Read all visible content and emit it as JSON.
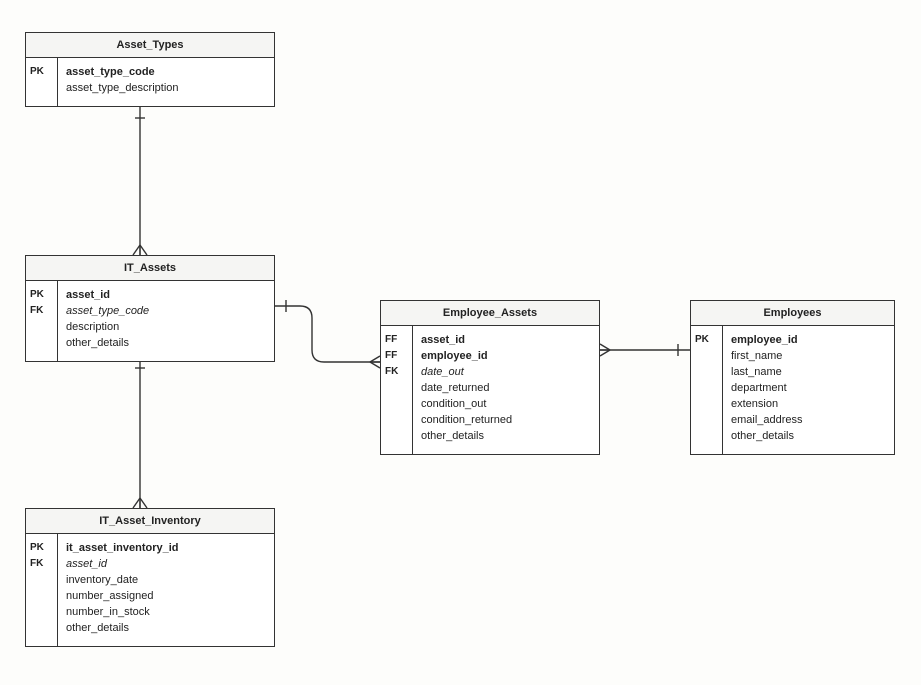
{
  "entities": {
    "asset_types": {
      "title": "Asset_Types",
      "keys": [
        "PK",
        ""
      ],
      "fields": [
        {
          "name": "asset_type_code",
          "bold": true
        },
        {
          "name": "asset_type_description"
        }
      ]
    },
    "it_assets": {
      "title": "IT_Assets",
      "keys": [
        "PK",
        "FK",
        "",
        ""
      ],
      "fields": [
        {
          "name": "asset_id",
          "bold": true
        },
        {
          "name": "asset_type_code",
          "italic": true
        },
        {
          "name": "description"
        },
        {
          "name": "other_details"
        }
      ]
    },
    "it_asset_inventory": {
      "title": "IT_Asset_Inventory",
      "keys": [
        "PK",
        "FK",
        "",
        "",
        "",
        ""
      ],
      "fields": [
        {
          "name": "it_asset_inventory_id",
          "bold": true
        },
        {
          "name": "asset_id",
          "italic": true
        },
        {
          "name": "inventory_date"
        },
        {
          "name": "number_assigned"
        },
        {
          "name": "number_in_stock"
        },
        {
          "name": "other_details"
        }
      ]
    },
    "employee_assets": {
      "title": "Employee_Assets",
      "keys": [
        "FF",
        "FF",
        "FK",
        "",
        "",
        "",
        ""
      ],
      "fields": [
        {
          "name": "asset_id",
          "bold": true
        },
        {
          "name": "employee_id",
          "bold": true
        },
        {
          "name": "date_out",
          "italic": true
        },
        {
          "name": "date_returned"
        },
        {
          "name": "condition_out"
        },
        {
          "name": "condition_returned"
        },
        {
          "name": "other_details"
        }
      ]
    },
    "employees": {
      "title": "Employees",
      "keys": [
        "PK",
        "",
        "",
        "",
        "",
        "",
        ""
      ],
      "fields": [
        {
          "name": "employee_id",
          "bold": true
        },
        {
          "name": "first_name"
        },
        {
          "name": "last_name"
        },
        {
          "name": "department"
        },
        {
          "name": "extension"
        },
        {
          "name": "email_address"
        },
        {
          "name": "other_details"
        }
      ]
    }
  },
  "relationships": [
    {
      "from": "asset_types",
      "to": "it_assets",
      "type": "one-to-many"
    },
    {
      "from": "it_assets",
      "to": "it_asset_inventory",
      "type": "one-to-many"
    },
    {
      "from": "it_assets",
      "to": "employee_assets",
      "type": "one-to-many"
    },
    {
      "from": "employees",
      "to": "employee_assets",
      "type": "one-to-many"
    }
  ]
}
